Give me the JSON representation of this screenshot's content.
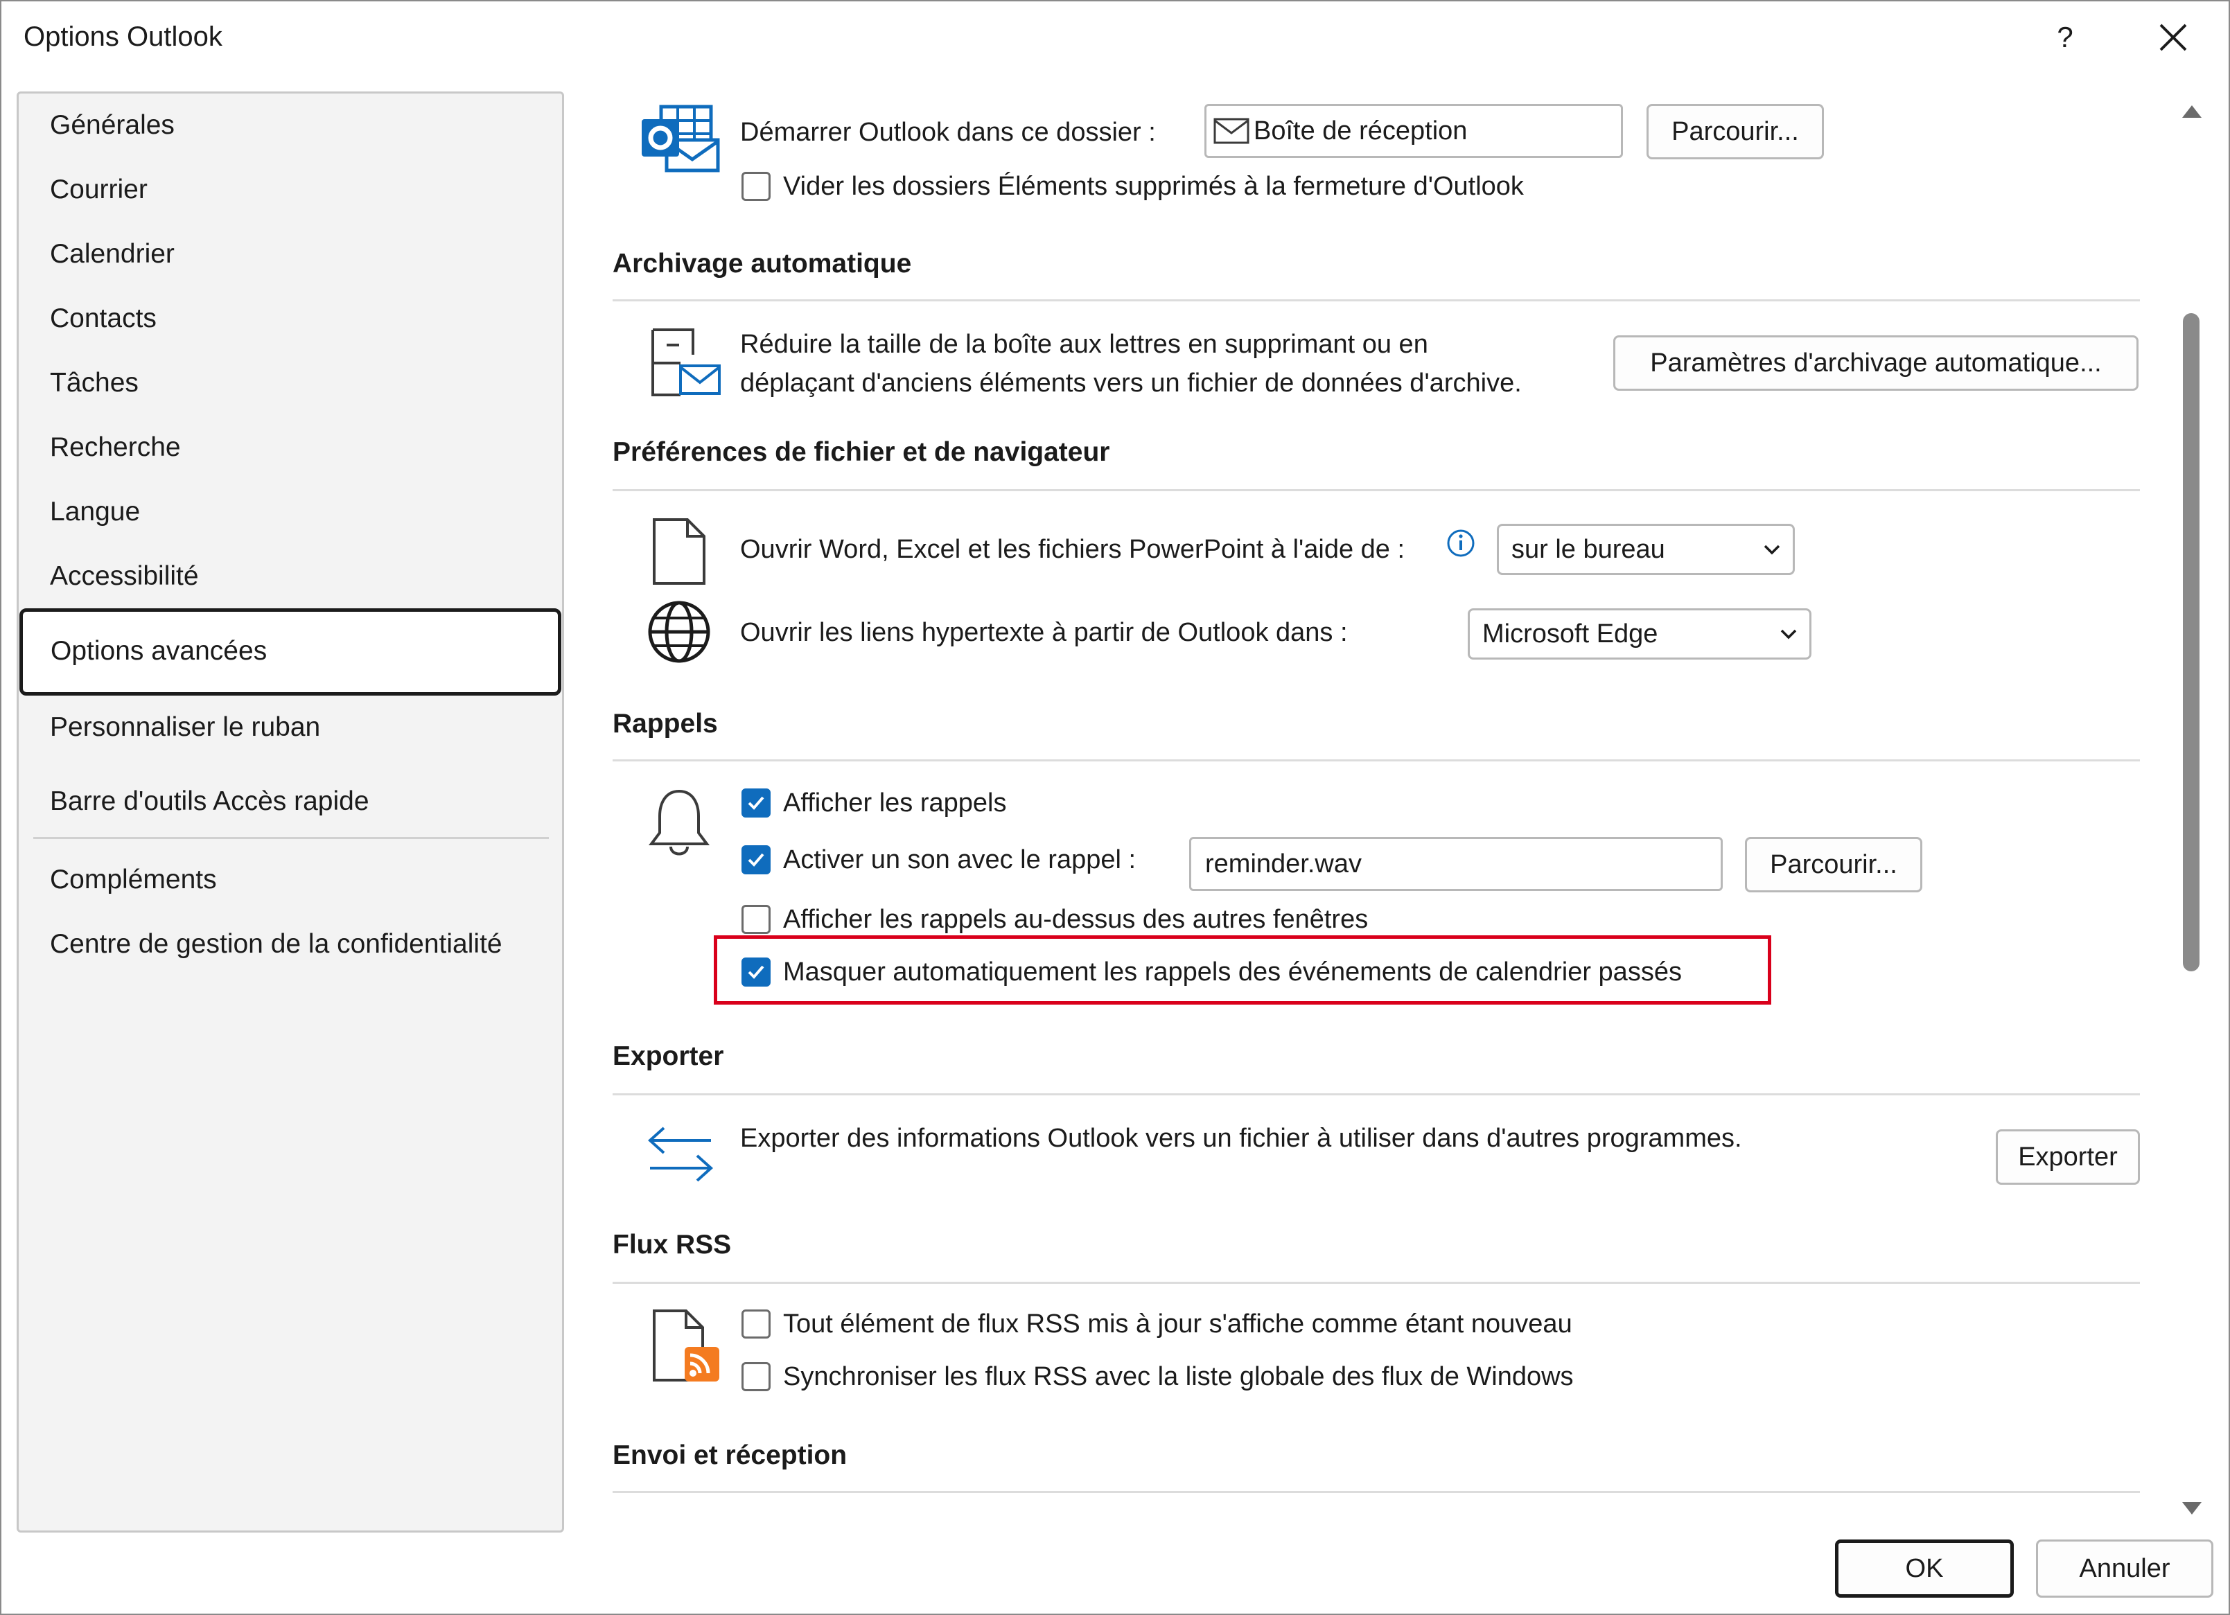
{
  "window": {
    "title": "Options Outlook",
    "help_label": "?",
    "close_label": "✕"
  },
  "sidebar": {
    "items": [
      {
        "label": "Générales"
      },
      {
        "label": "Courrier"
      },
      {
        "label": "Calendrier"
      },
      {
        "label": "Contacts"
      },
      {
        "label": "Tâches"
      },
      {
        "label": "Recherche"
      },
      {
        "label": "Langue"
      },
      {
        "label": "Accessibilité"
      },
      {
        "label": "Options avancées",
        "selected": true
      },
      {
        "label": "Personnaliser le ruban"
      },
      {
        "label": "Barre d'outils Accès rapide"
      },
      {
        "label": "Compléments"
      },
      {
        "label": "Centre de gestion de la confidentialité"
      }
    ]
  },
  "start": {
    "folder_label": "Démarrer Outlook dans ce dossier :",
    "folder_value": "Boîte de réception",
    "browse_label": "Parcourir...",
    "empty_deleted_label": "Vider les dossiers Éléments supprimés à la fermeture d'Outlook",
    "empty_deleted_checked": false
  },
  "autoarchive": {
    "header": "Archivage automatique",
    "line1": "Réduire la taille de la boîte aux lettres en supprimant ou en",
    "line2": "déplaçant d'anciens éléments vers un fichier de données d'archive.",
    "button_label": "Paramètres d'archivage automatique..."
  },
  "file_prefs": {
    "header": "Préférences de fichier et de navigateur",
    "open_files_label": "Ouvrir Word, Excel et les fichiers PowerPoint à l'aide de :",
    "open_files_value": "sur le bureau",
    "open_links_label": "Ouvrir les liens hypertexte à partir de Outlook dans :",
    "open_links_value": "Microsoft Edge"
  },
  "reminders": {
    "header": "Rappels",
    "show_label": "Afficher les rappels",
    "show_checked": true,
    "sound_label": "Activer un son avec le rappel :",
    "sound_checked": true,
    "sound_file": "reminder.wav",
    "browse_label": "Parcourir...",
    "on_top_label": "Afficher les rappels au-dessus des autres fenêtres",
    "on_top_checked": false,
    "auto_dismiss_label": "Masquer automatiquement les rappels des événements de calendrier passés",
    "auto_dismiss_checked": true,
    "highlight_color": "#d9001b"
  },
  "export": {
    "header": "Exporter",
    "description": "Exporter des informations Outlook vers un fichier à utiliser dans d'autres programmes.",
    "button_label": "Exporter"
  },
  "rss": {
    "header": "Flux RSS",
    "new_label": "Tout élément de flux RSS mis à jour s'affiche comme étant nouveau",
    "new_checked": false,
    "sync_label": "Synchroniser les flux RSS avec la liste globale des flux de Windows",
    "sync_checked": false
  },
  "send_receive": {
    "header": "Envoi et réception"
  },
  "footer": {
    "ok_label": "OK",
    "cancel_label": "Annuler"
  },
  "colors": {
    "accent": "#0f6cbd",
    "border": "#b8b8b8",
    "sidebar_bg": "#f3f3f3"
  }
}
